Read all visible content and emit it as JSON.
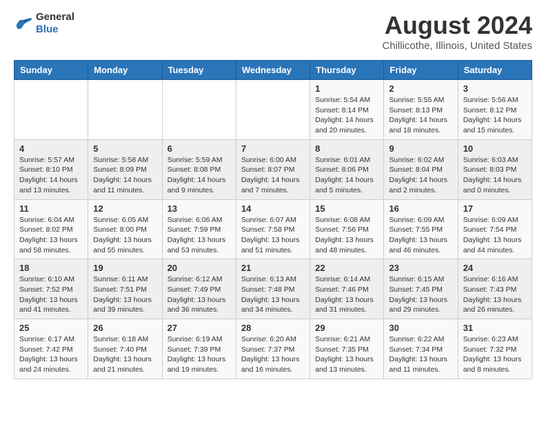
{
  "logo": {
    "general": "General",
    "blue": "Blue"
  },
  "title": "August 2024",
  "subtitle": "Chillicothe, Illinois, United States",
  "days_of_week": [
    "Sunday",
    "Monday",
    "Tuesday",
    "Wednesday",
    "Thursday",
    "Friday",
    "Saturday"
  ],
  "weeks": [
    {
      "days": [
        {
          "number": "",
          "info": ""
        },
        {
          "number": "",
          "info": ""
        },
        {
          "number": "",
          "info": ""
        },
        {
          "number": "",
          "info": ""
        },
        {
          "number": "1",
          "info": "Sunrise: 5:54 AM\nSunset: 8:14 PM\nDaylight: 14 hours\nand 20 minutes."
        },
        {
          "number": "2",
          "info": "Sunrise: 5:55 AM\nSunset: 8:13 PM\nDaylight: 14 hours\nand 18 minutes."
        },
        {
          "number": "3",
          "info": "Sunrise: 5:56 AM\nSunset: 8:12 PM\nDaylight: 14 hours\nand 15 minutes."
        }
      ]
    },
    {
      "days": [
        {
          "number": "4",
          "info": "Sunrise: 5:57 AM\nSunset: 8:10 PM\nDaylight: 14 hours\nand 13 minutes."
        },
        {
          "number": "5",
          "info": "Sunrise: 5:58 AM\nSunset: 8:09 PM\nDaylight: 14 hours\nand 11 minutes."
        },
        {
          "number": "6",
          "info": "Sunrise: 5:59 AM\nSunset: 8:08 PM\nDaylight: 14 hours\nand 9 minutes."
        },
        {
          "number": "7",
          "info": "Sunrise: 6:00 AM\nSunset: 8:07 PM\nDaylight: 14 hours\nand 7 minutes."
        },
        {
          "number": "8",
          "info": "Sunrise: 6:01 AM\nSunset: 8:06 PM\nDaylight: 14 hours\nand 5 minutes."
        },
        {
          "number": "9",
          "info": "Sunrise: 6:02 AM\nSunset: 8:04 PM\nDaylight: 14 hours\nand 2 minutes."
        },
        {
          "number": "10",
          "info": "Sunrise: 6:03 AM\nSunset: 8:03 PM\nDaylight: 14 hours\nand 0 minutes."
        }
      ]
    },
    {
      "days": [
        {
          "number": "11",
          "info": "Sunrise: 6:04 AM\nSunset: 8:02 PM\nDaylight: 13 hours\nand 58 minutes."
        },
        {
          "number": "12",
          "info": "Sunrise: 6:05 AM\nSunset: 8:00 PM\nDaylight: 13 hours\nand 55 minutes."
        },
        {
          "number": "13",
          "info": "Sunrise: 6:06 AM\nSunset: 7:59 PM\nDaylight: 13 hours\nand 53 minutes."
        },
        {
          "number": "14",
          "info": "Sunrise: 6:07 AM\nSunset: 7:58 PM\nDaylight: 13 hours\nand 51 minutes."
        },
        {
          "number": "15",
          "info": "Sunrise: 6:08 AM\nSunset: 7:56 PM\nDaylight: 13 hours\nand 48 minutes."
        },
        {
          "number": "16",
          "info": "Sunrise: 6:09 AM\nSunset: 7:55 PM\nDaylight: 13 hours\nand 46 minutes."
        },
        {
          "number": "17",
          "info": "Sunrise: 6:09 AM\nSunset: 7:54 PM\nDaylight: 13 hours\nand 44 minutes."
        }
      ]
    },
    {
      "days": [
        {
          "number": "18",
          "info": "Sunrise: 6:10 AM\nSunset: 7:52 PM\nDaylight: 13 hours\nand 41 minutes."
        },
        {
          "number": "19",
          "info": "Sunrise: 6:11 AM\nSunset: 7:51 PM\nDaylight: 13 hours\nand 39 minutes."
        },
        {
          "number": "20",
          "info": "Sunrise: 6:12 AM\nSunset: 7:49 PM\nDaylight: 13 hours\nand 36 minutes."
        },
        {
          "number": "21",
          "info": "Sunrise: 6:13 AM\nSunset: 7:48 PM\nDaylight: 13 hours\nand 34 minutes."
        },
        {
          "number": "22",
          "info": "Sunrise: 6:14 AM\nSunset: 7:46 PM\nDaylight: 13 hours\nand 31 minutes."
        },
        {
          "number": "23",
          "info": "Sunrise: 6:15 AM\nSunset: 7:45 PM\nDaylight: 13 hours\nand 29 minutes."
        },
        {
          "number": "24",
          "info": "Sunrise: 6:16 AM\nSunset: 7:43 PM\nDaylight: 13 hours\nand 26 minutes."
        }
      ]
    },
    {
      "days": [
        {
          "number": "25",
          "info": "Sunrise: 6:17 AM\nSunset: 7:42 PM\nDaylight: 13 hours\nand 24 minutes."
        },
        {
          "number": "26",
          "info": "Sunrise: 6:18 AM\nSunset: 7:40 PM\nDaylight: 13 hours\nand 21 minutes."
        },
        {
          "number": "27",
          "info": "Sunrise: 6:19 AM\nSunset: 7:39 PM\nDaylight: 13 hours\nand 19 minutes."
        },
        {
          "number": "28",
          "info": "Sunrise: 6:20 AM\nSunset: 7:37 PM\nDaylight: 13 hours\nand 16 minutes."
        },
        {
          "number": "29",
          "info": "Sunrise: 6:21 AM\nSunset: 7:35 PM\nDaylight: 13 hours\nand 13 minutes."
        },
        {
          "number": "30",
          "info": "Sunrise: 6:22 AM\nSunset: 7:34 PM\nDaylight: 13 hours\nand 11 minutes."
        },
        {
          "number": "31",
          "info": "Sunrise: 6:23 AM\nSunset: 7:32 PM\nDaylight: 13 hours\nand 8 minutes."
        }
      ]
    }
  ]
}
